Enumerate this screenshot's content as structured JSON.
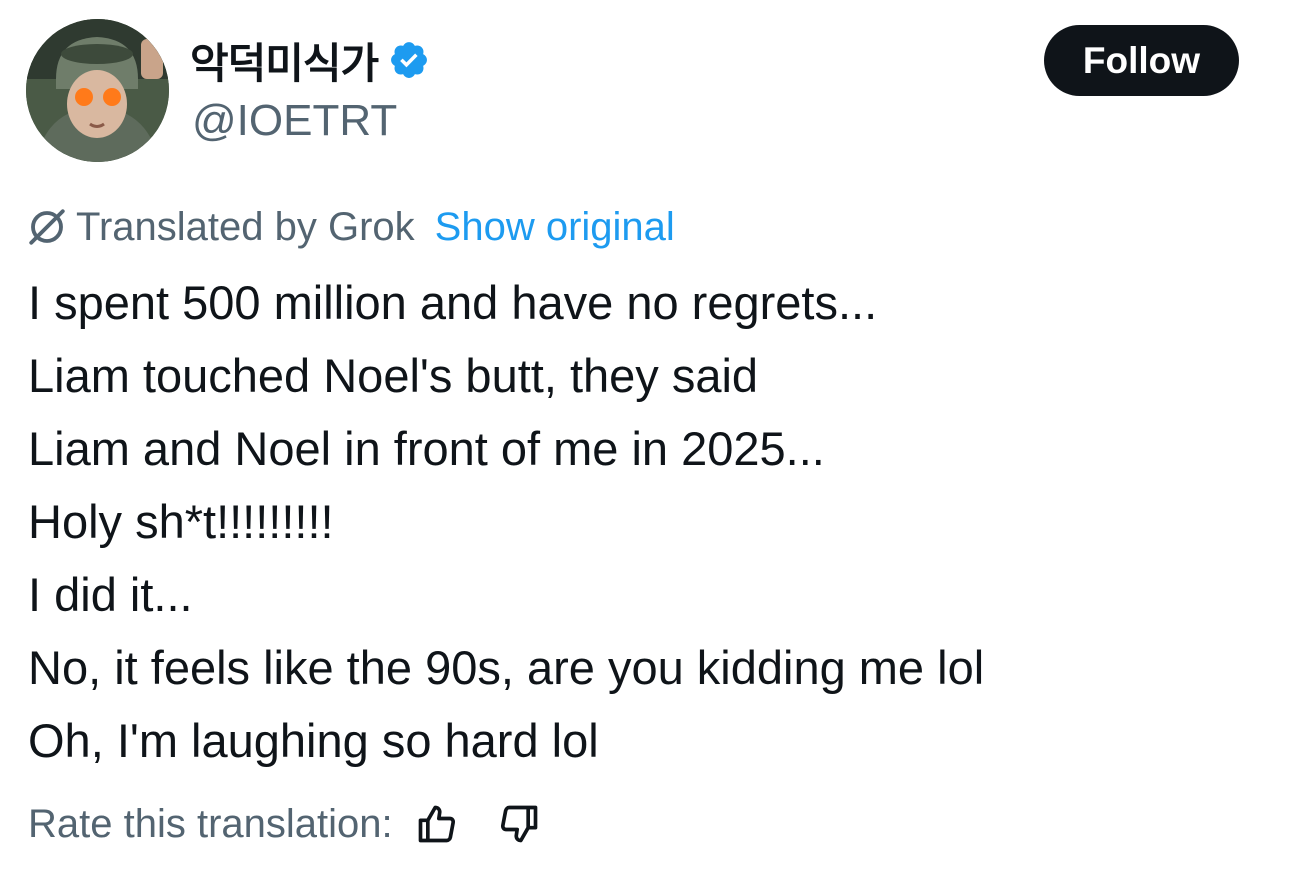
{
  "author": {
    "display_name": "악덕미식가",
    "handle": "@IOETRT",
    "verified": true,
    "avatar_icon": "avatar-photo"
  },
  "follow_button": {
    "label": "Follow"
  },
  "translation": {
    "icon": "grok-icon",
    "label": "Translated by Grok",
    "show_original_label": "Show original"
  },
  "tweet": {
    "lines": [
      "I spent 500 million and have no regrets...",
      "Liam touched Noel's butt, they said",
      "Liam and Noel in front of me in 2025...",
      "Holy sh*t!!!!!!!!!",
      "I did it...",
      "No, it feels like the 90s, are you kidding me lol",
      "Oh, I'm laughing so hard lol"
    ]
  },
  "rating": {
    "label": "Rate this translation:",
    "thumbs_up_icon": "thumbs-up-icon",
    "thumbs_down_icon": "thumbs-down-icon"
  },
  "colors": {
    "text_primary": "#0f1419",
    "text_secondary": "#536471",
    "accent_blue": "#1d9bf0",
    "follow_button_bg": "#0f1419",
    "follow_button_text": "#ffffff"
  }
}
